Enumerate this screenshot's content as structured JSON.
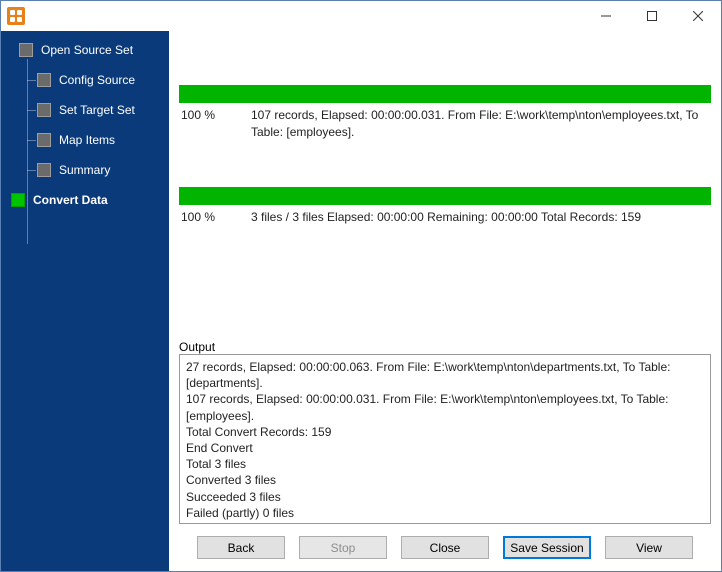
{
  "sidebar": {
    "items": [
      {
        "label": "Open Source Set"
      },
      {
        "label": "Config Source"
      },
      {
        "label": "Set Target Set"
      },
      {
        "label": "Map Items"
      },
      {
        "label": "Summary"
      },
      {
        "label": "Convert Data"
      }
    ]
  },
  "progress": {
    "file": {
      "percent": "100 %",
      "line": "107 records,    Elapsed: 00:00:00.031.    From File: E:\\work\\temp\\nton\\employees.txt,    To Table: [employees]."
    },
    "overall": {
      "percent": "100 %",
      "line": "3 files / 3 files    Elapsed: 00:00:00    Remaining: 00:00:00    Total Records: 159"
    }
  },
  "output": {
    "label": "Output",
    "lines": [
      "27 records,    Elapsed: 00:00:00.063.    From File: E:\\work\\temp\\nton\\departments.txt,    To Table: [departments].",
      "107 records,    Elapsed: 00:00:00.031.    From File: E:\\work\\temp\\nton\\employees.txt,    To Table: [employees].",
      "Total Convert Records: 159",
      "End Convert",
      "Total 3 files",
      "Converted 3 files",
      "Succeeded 3 files",
      "Failed (partly) 0 files"
    ]
  },
  "buttons": {
    "back": "Back",
    "stop": "Stop",
    "close": "Close",
    "save": "Save Session",
    "view": "View"
  }
}
